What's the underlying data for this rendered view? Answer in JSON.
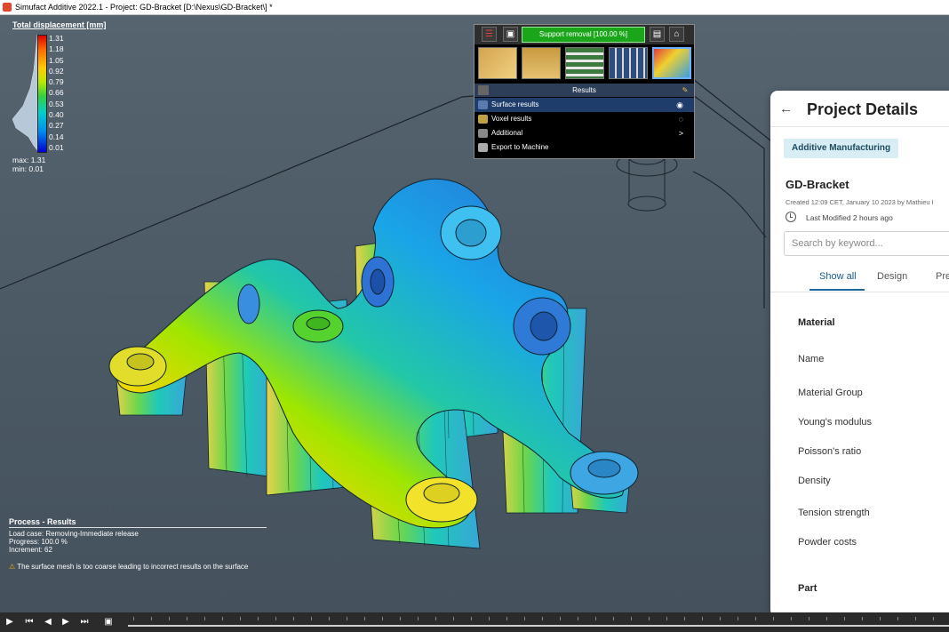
{
  "window": {
    "title": "Simufact Additive 2022.1 - Project: GD-Bracket [D:\\Nexus\\GD-Bracket\\] *"
  },
  "legend": {
    "title": "Total displacement [mm]",
    "ticks": [
      "1.31",
      "1.18",
      "1.05",
      "0.92",
      "0.79",
      "0.66",
      "0.53",
      "0.40",
      "0.27",
      "0.14",
      "0.01"
    ],
    "max_label": "max: 1.31",
    "min_label": "min:  0.01"
  },
  "panel": {
    "support_removal": "Support removal [100.00 %]",
    "results_header": "Results",
    "menu": [
      {
        "label": "Surface results",
        "selected": true,
        "right": "eye-icon"
      },
      {
        "label": "Voxel results",
        "selected": false,
        "right": "voxel-icon"
      },
      {
        "label": "Additional",
        "selected": false,
        "right": ">"
      },
      {
        "label": "Export to Machine",
        "selected": false,
        "right": ""
      }
    ]
  },
  "process": {
    "title": "Process - Results",
    "load_case": "Load case: Removing-Immediate release",
    "progress": "Progress: 100.0 %",
    "increment": "Increment: 62",
    "warning": "The surface mesh is too coarse leading to incorrect results on the surface"
  },
  "details": {
    "title": "Project Details",
    "badge": "Additive Manufacturing",
    "project_name": "GD-Bracket",
    "created": "Created 12:09 CET, January 10 2023 by Mathieu I",
    "modified": "Last Modified 2 hours ago",
    "search_placeholder": "Search by keyword...",
    "tabs": [
      "Show all",
      "Design",
      "Pre"
    ],
    "sections": {
      "material": "Material",
      "part": "Part"
    },
    "rows": [
      "Name",
      "Material Group",
      "Young's modulus",
      "Poisson's ratio",
      "Density",
      "Tension strength",
      "Powder costs"
    ]
  },
  "colors": {
    "accent_green": "#1ba51b",
    "selection_blue": "#1e3d6b",
    "badge_bg": "#d8eef4"
  }
}
